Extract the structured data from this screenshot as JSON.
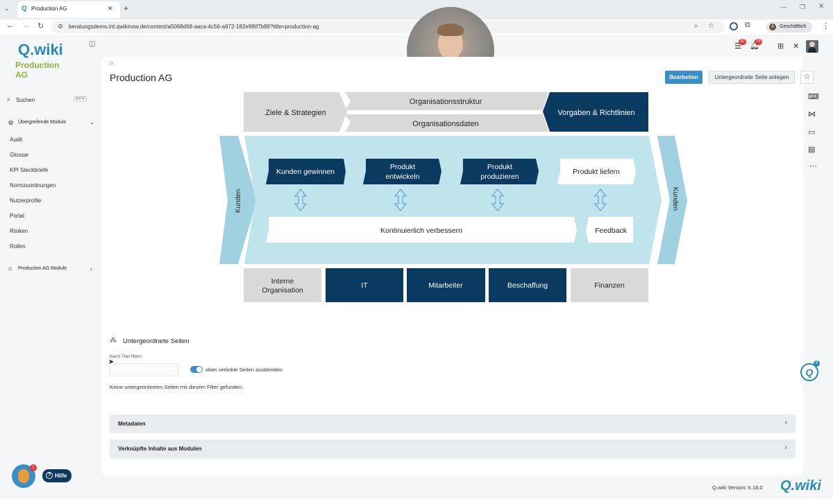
{
  "browser": {
    "tab_title": "Production AG",
    "url": "beratungsdemo.int.qwikinow.de/content/a5068d68-aaca-4c56-a972-182e9f6f7b89?title=production-ag",
    "profile_initial": "A",
    "profile_label": "Geschäftlich"
  },
  "sidebar": {
    "logo_text": "Q.wiki",
    "logo_sub": "Production AG",
    "search_label": "Suchen",
    "search_shortcut": "ctrl k",
    "section_label": "Übergreifende Module",
    "items": [
      "Audit",
      "Glossar",
      "KPI Steckbriefe",
      "Normzuordnungen",
      "Nutzerprofile",
      "Portal",
      "Risiken",
      "Rollen"
    ],
    "section2_label": "Production AG Module"
  },
  "header": {
    "badge_tasks": "32",
    "badge_notifications": "79"
  },
  "page": {
    "title": "Production AG",
    "edit_button": "Bearbeiten",
    "create_child_button": "Untergeordnete Seite anlegen"
  },
  "diagram": {
    "top_left": "Ziele & Strategien",
    "top_mid_upper": "Organisationsstruktur",
    "top_mid_lower": "Organisationsdaten",
    "top_right": "Vorgaben & Richtlinien",
    "left_side": "Kunden",
    "right_side": "Kunden",
    "process": [
      "Kunden gewinnen",
      "Produkt entwickeln",
      "Produkt produzieren",
      "Produkt liefern"
    ],
    "improve": "Kontinuierlich verbessern",
    "feedback": "Feedback",
    "support": [
      "Interne Organisation",
      "IT",
      "Mitarbeiter",
      "Beschaffung",
      "Finanzen"
    ]
  },
  "subpages": {
    "heading": "Untergeordnete Seiten",
    "filter_label": "Nach Titel filtern",
    "filter_value": "",
    "toggle_label": "oben verlinkte Seiten ausblenden",
    "empty_text": "Keine untergeordneten Seiten mit diesem Filter gefunden."
  },
  "accordions": [
    "Metadaten",
    "Verknüpfte Inhalte aus Modulen"
  ],
  "footer": {
    "help_label": "Hilfe",
    "help_badge": "1",
    "assistant_badge": "5",
    "version": "Q.wiki Version: 6.18.0",
    "logo": "Q.wiki"
  },
  "colors": {
    "dark_blue": "#0b3a60",
    "light_blue": "#9fd1e0",
    "pale_blue": "#bfe4ec",
    "grey": "#d9d9d9",
    "logo_blue": "#2a8ab8",
    "logo_green": "#8db33a",
    "primary_button": "#3a8fc9"
  }
}
